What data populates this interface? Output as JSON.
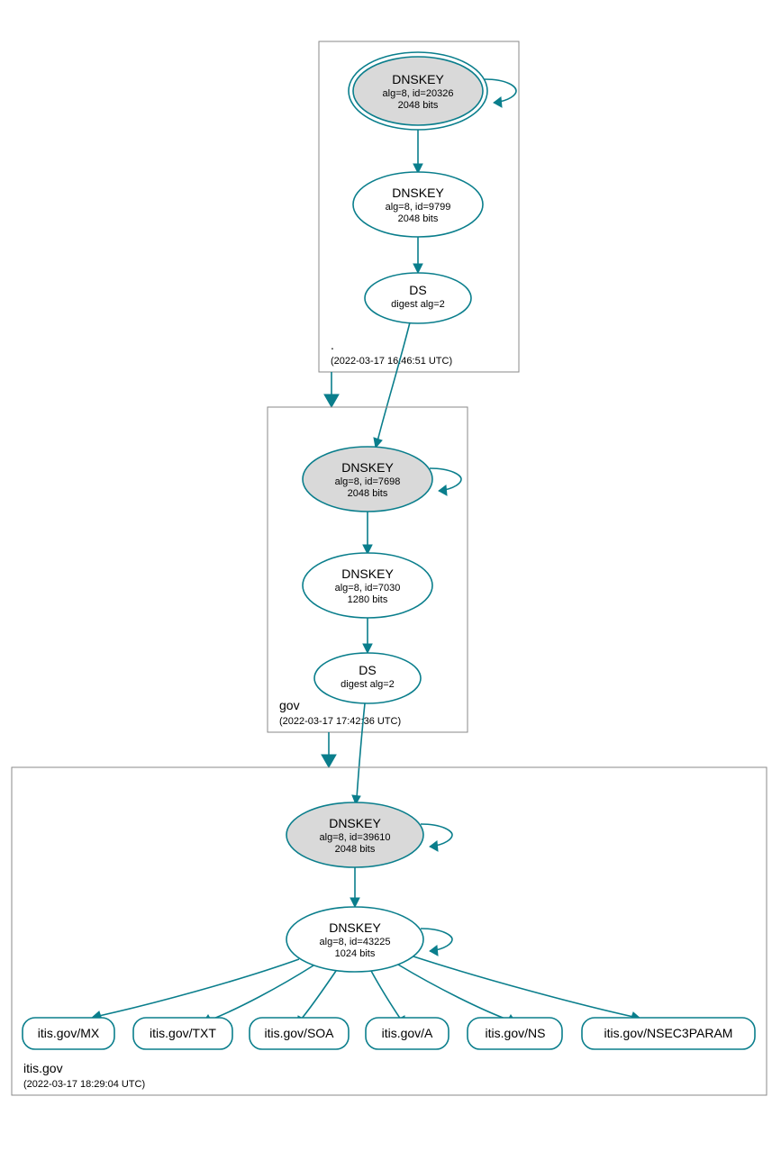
{
  "colors": {
    "edge": "#0a7e8c",
    "shaded": "#d9d9d9",
    "box": "#8a8a8a"
  },
  "zones": {
    "root": {
      "label": ".",
      "timestamp": "(2022-03-17 16:46:51 UTC)",
      "ksk": {
        "title": "DNSKEY",
        "line1": "alg=8, id=20326",
        "line2": "2048 bits"
      },
      "zsk": {
        "title": "DNSKEY",
        "line1": "alg=8, id=9799",
        "line2": "2048 bits"
      },
      "ds": {
        "title": "DS",
        "line1": "digest alg=2"
      }
    },
    "gov": {
      "label": "gov",
      "timestamp": "(2022-03-17 17:42:36 UTC)",
      "ksk": {
        "title": "DNSKEY",
        "line1": "alg=8, id=7698",
        "line2": "2048 bits"
      },
      "zsk": {
        "title": "DNSKEY",
        "line1": "alg=8, id=7030",
        "line2": "1280 bits"
      },
      "ds": {
        "title": "DS",
        "line1": "digest alg=2"
      }
    },
    "itis": {
      "label": "itis.gov",
      "timestamp": "(2022-03-17 18:29:04 UTC)",
      "ksk": {
        "title": "DNSKEY",
        "line1": "alg=8, id=39610",
        "line2": "2048 bits"
      },
      "zsk": {
        "title": "DNSKEY",
        "line1": "alg=8, id=43225",
        "line2": "1024 bits"
      },
      "records": [
        "itis.gov/MX",
        "itis.gov/TXT",
        "itis.gov/SOA",
        "itis.gov/A",
        "itis.gov/NS",
        "itis.gov/NSEC3PARAM"
      ]
    }
  }
}
